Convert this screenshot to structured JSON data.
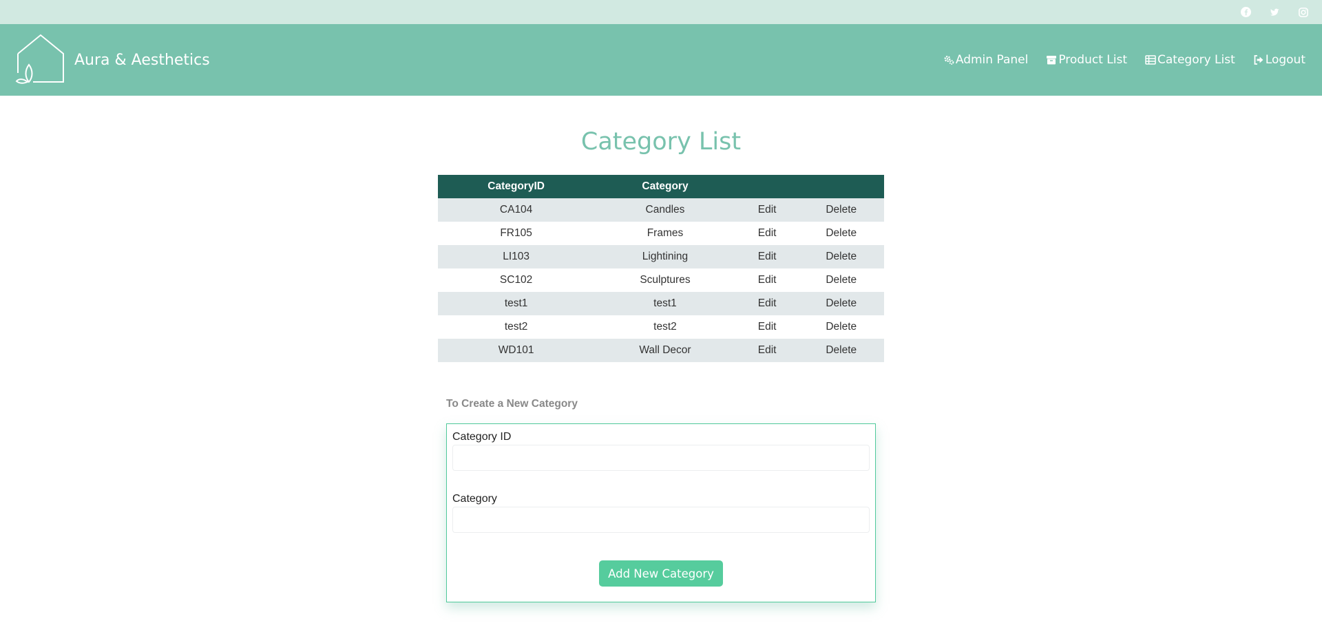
{
  "brand": {
    "name": "Aura & Aesthetics"
  },
  "social": [
    "facebook-icon",
    "twitter-icon",
    "instagram-icon"
  ],
  "nav": {
    "admin_panel": "Admin Panel",
    "product_list": "Product List",
    "category_list": "Category List",
    "logout": "Logout"
  },
  "page": {
    "title": "Category List"
  },
  "table": {
    "headers": {
      "id": "CategoryID",
      "category": "Category"
    },
    "rows": [
      {
        "id": "CA104",
        "category": "Candles",
        "edit": "Edit",
        "delete": "Delete"
      },
      {
        "id": "FR105",
        "category": "Frames",
        "edit": "Edit",
        "delete": "Delete"
      },
      {
        "id": "LI103",
        "category": "Lightining",
        "edit": "Edit",
        "delete": "Delete"
      },
      {
        "id": "SC102",
        "category": "Sculptures",
        "edit": "Edit",
        "delete": "Delete"
      },
      {
        "id": "test1",
        "category": "test1",
        "edit": "Edit",
        "delete": "Delete"
      },
      {
        "id": "test2",
        "category": "test2",
        "edit": "Edit",
        "delete": "Delete"
      },
      {
        "id": "WD101",
        "category": "Wall Decor",
        "edit": "Edit",
        "delete": "Delete"
      }
    ]
  },
  "form": {
    "heading": "To Create a New Category",
    "category_id_label": "Category ID",
    "category_id_value": "",
    "category_label": "Category",
    "category_value": "",
    "submit_label": "Add New Category"
  },
  "colors": {
    "topbar": "#d1e9e1",
    "navbar": "#78c2ad",
    "table_header": "#1e5c54",
    "row_stripe": "#e2e8ea",
    "button": "#56cc9d"
  }
}
